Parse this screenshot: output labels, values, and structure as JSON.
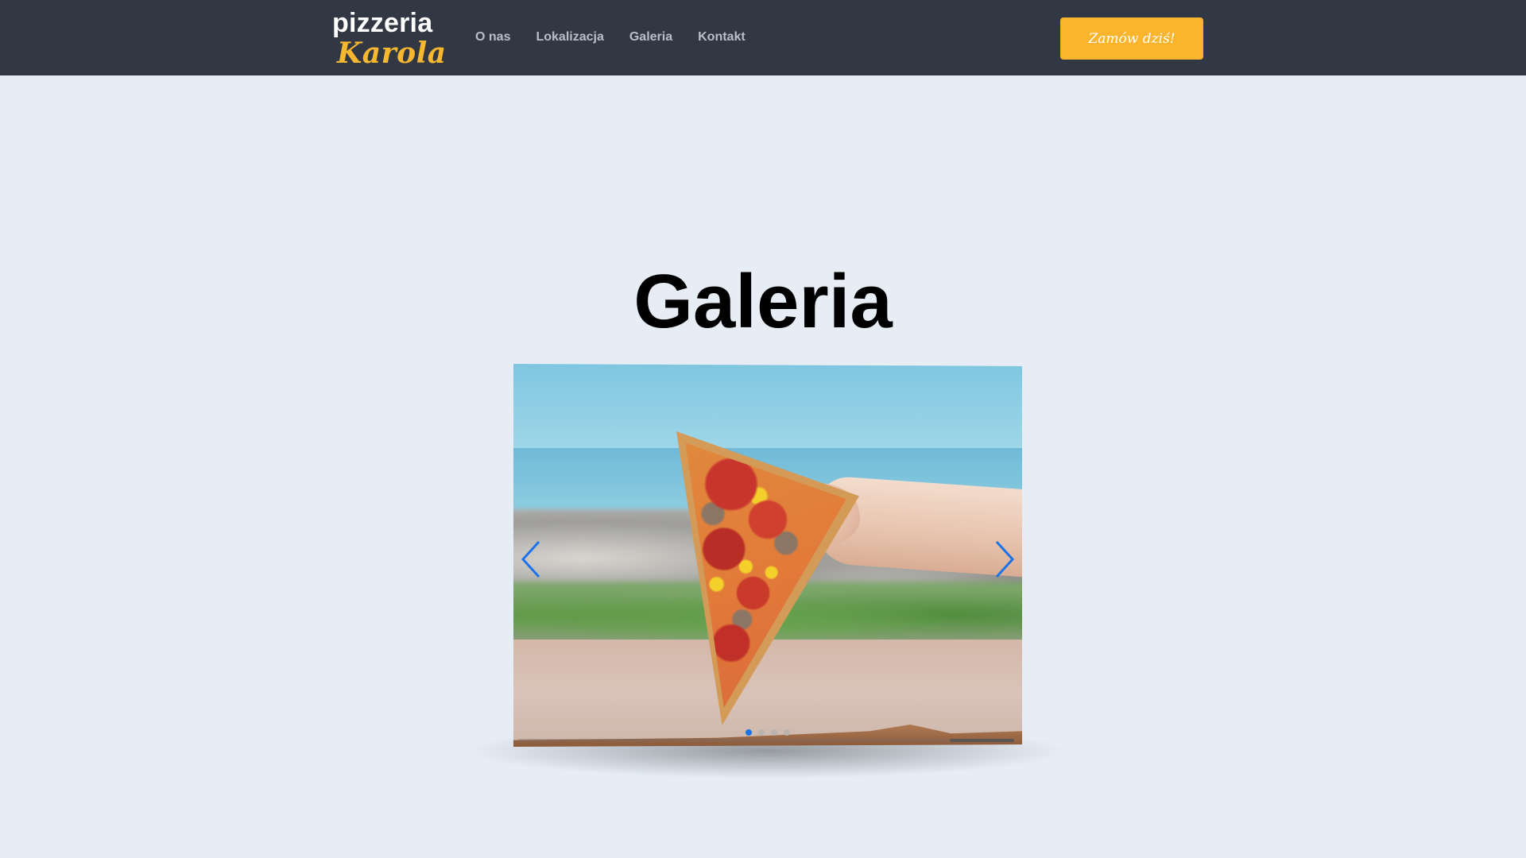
{
  "header": {
    "logo_line1": "pizzeria",
    "logo_line2": "Karola",
    "nav": [
      {
        "label": "O nas"
      },
      {
        "label": "Lokalizacja"
      },
      {
        "label": "Galeria"
      },
      {
        "label": "Kontakt"
      }
    ],
    "cta_label": "Zamów dziś!"
  },
  "gallery": {
    "title": "Galeria",
    "slide_count": 4,
    "active_slide": 1,
    "progress_fraction": 0.13
  },
  "icons": {
    "prev": "chevron-left-icon",
    "next": "chevron-right-icon"
  },
  "colors": {
    "header_bg": "#313843",
    "page_bg": "#e6edf5",
    "accent": "#fbb52c",
    "arrow": "#1a73e8"
  }
}
